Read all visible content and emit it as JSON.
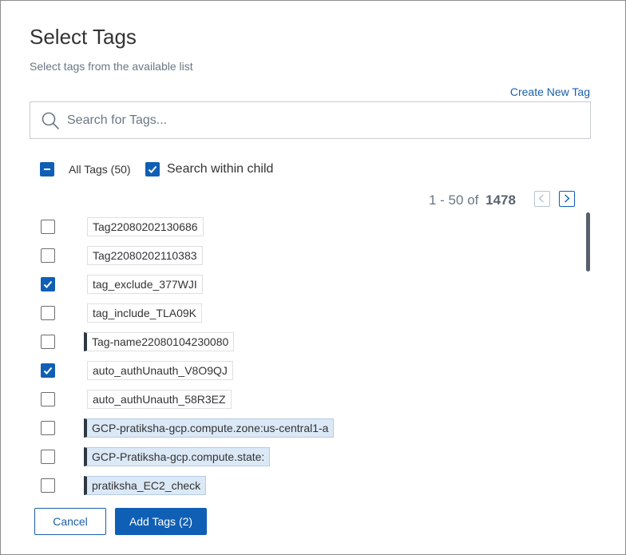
{
  "dialog": {
    "title": "Select Tags",
    "subtitle": "Select tags from the available list",
    "create_link": "Create New Tag"
  },
  "search": {
    "placeholder": "Search for Tags...",
    "value": ""
  },
  "filters": {
    "all_tags_label": "All Tags (50)",
    "all_tags_state": "indeterminate",
    "search_child_label": "Search within child",
    "search_child_checked": true
  },
  "pagination": {
    "range": "1 - 50 of",
    "total": "1478"
  },
  "tags": [
    {
      "label": "Tag22080202130686",
      "checked": false
    },
    {
      "label": "Tag22080202110383",
      "checked": false
    },
    {
      "label": "tag_exclude_377WJI",
      "checked": true
    },
    {
      "label": "tag_include_TLA09K",
      "checked": false
    },
    {
      "label": "Tag-name22080104230080",
      "checked": false
    },
    {
      "label": "auto_authUnauth_V8O9QJ",
      "checked": true
    },
    {
      "label": "auto_authUnauth_58R3EZ",
      "checked": false
    },
    {
      "label": "GCP-pratiksha-gcp.compute.zone:us-central1-a",
      "checked": false
    },
    {
      "label": "GCP-Pratiksha-gcp.compute.state:",
      "checked": false
    },
    {
      "label": "pratiksha_EC2_check",
      "checked": false
    }
  ],
  "actions": {
    "cancel_label": "Cancel",
    "add_label": "Add Tags (2)"
  },
  "colors": {
    "primary": "#0f5fb5",
    "link": "#1a5fa8",
    "tag_highlight": "#dbe8f6"
  }
}
